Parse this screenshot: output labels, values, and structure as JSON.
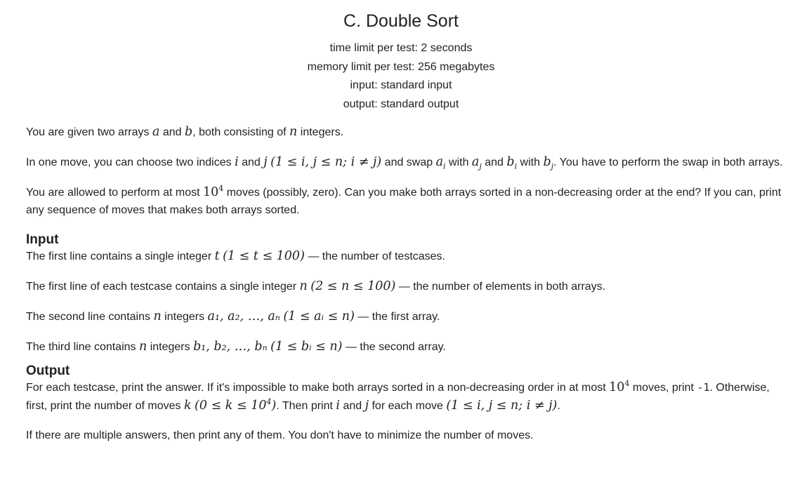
{
  "header": {
    "title": "C. Double Sort",
    "time_limit": "time limit per test: 2 seconds",
    "memory_limit": "memory limit per test: 256 megabytes",
    "input": "input: standard input",
    "output": "output: standard output"
  },
  "statement": {
    "p1": {
      "t1": "You are given two arrays ",
      "m1": "a",
      "t2": " and ",
      "m2": "b",
      "t3": ", both consisting of ",
      "m3": "n",
      "t4": " integers."
    },
    "p2": {
      "t1": "In one move, you can choose two indices ",
      "m1": "i",
      "t2": " and ",
      "m2": "j",
      "m3": "(1 ≤ i, j ≤ n; i ≠ j)",
      "t3": " and swap ",
      "m4": "a",
      "m4sub": "i",
      "t4": " with ",
      "m5": "a",
      "m5sub": "j",
      "t5": " and ",
      "m6": "b",
      "m6sub": "i",
      "t6": " with ",
      "m7": "b",
      "m7sub": "j",
      "t7": ". You have to perform the swap in both arrays."
    },
    "p3": {
      "t1": "You are allowed to perform at most ",
      "m1": "10",
      "m1sup": "4",
      "t2": " moves (possibly, zero). Can you make both arrays sorted in a non-decreasing order at the end? If you can, print any sequence of moves that makes both arrays sorted."
    }
  },
  "input_section": {
    "title": "Input",
    "l1": {
      "t1": "The first line contains a single integer ",
      "m1": "t",
      "m2": "(1 ≤ t ≤ 100)",
      "t2": " — the number of testcases."
    },
    "l2": {
      "t1": "The first line of each testcase contains a single integer ",
      "m1": "n",
      "m2": "(2 ≤ n ≤ 100)",
      "t2": " — the number of elements in both arrays."
    },
    "l3": {
      "t1": "The second line contains ",
      "m1": "n",
      "t2": " integers ",
      "m2": "a₁, a₂, …, aₙ",
      "m3": "(1 ≤ aᵢ ≤ n)",
      "t3": " — the first array."
    },
    "l4": {
      "t1": "The third line contains ",
      "m1": "n",
      "t2": " integers ",
      "m2": "b₁, b₂, …, bₙ",
      "m3": "(1 ≤ bᵢ ≤ n)",
      "t3": " — the second array."
    }
  },
  "output_section": {
    "title": "Output",
    "l1": {
      "t1": "For each testcase, print the answer. If it's impossible to make both arrays sorted in a non-decreasing order in at most ",
      "m1": "10",
      "m1sup": "4",
      "t2": " moves, print ",
      "code": "-1",
      "t3": ". Otherwise, first, print the number of moves ",
      "m2": "k",
      "m3a": "(0 ≤ k ≤ 10",
      "m3sup": "4",
      "m3b": ")",
      "t4": ". Then print ",
      "m4": "i",
      "t5": " and ",
      "m5": "j",
      "t6": " for each move ",
      "m6": "(1 ≤ i, j ≤ n; i ≠ j)",
      "t7": "."
    },
    "l2": {
      "t1": "If there are multiple answers, then print any of them. You don't have to minimize the number of moves."
    }
  }
}
